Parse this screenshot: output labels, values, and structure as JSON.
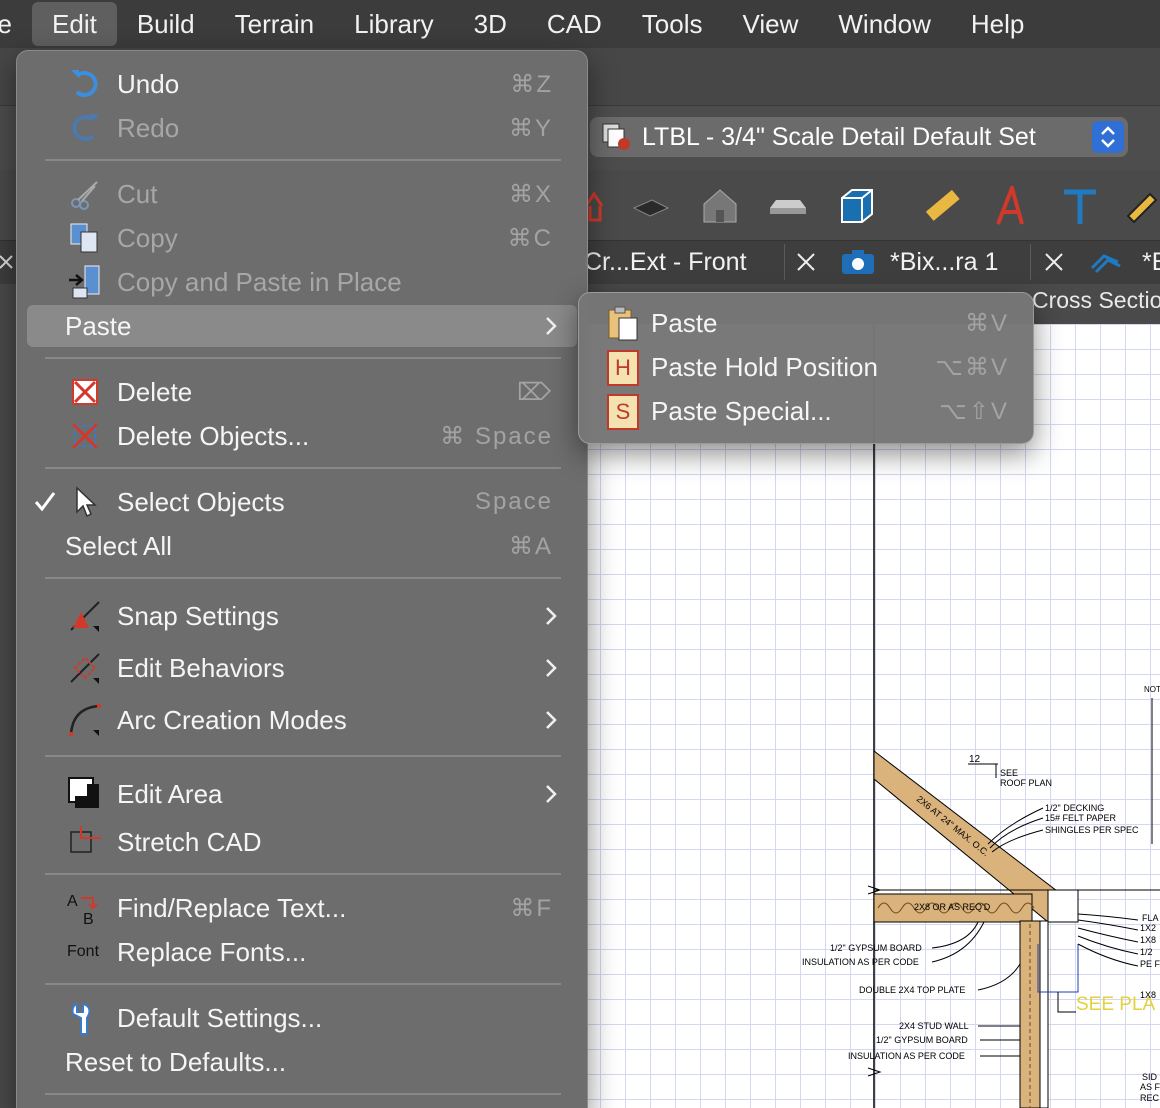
{
  "menubar": {
    "items": [
      "ile",
      "Edit",
      "Build",
      "Terrain",
      "Library",
      "3D",
      "CAD",
      "Tools",
      "View",
      "Window",
      "Help"
    ],
    "active": "Edit"
  },
  "toolbar": {
    "default_set": "LTBL - 3/4\" Scale Detail Default Set"
  },
  "tabs": {
    "tab1_label": "Cr...Ext - Front",
    "tab2_label": "*Bix...ra 1",
    "tab3_label": "*E",
    "cross_section_label": "Cross Sectio"
  },
  "edit_menu": {
    "undo": {
      "label": "Undo",
      "shortcut": "⌘Z"
    },
    "redo": {
      "label": "Redo",
      "shortcut": "⌘Y"
    },
    "cut": {
      "label": "Cut",
      "shortcut": "⌘X"
    },
    "copy": {
      "label": "Copy",
      "shortcut": "⌘C"
    },
    "copy_paste_in_place": {
      "label": "Copy and Paste in Place"
    },
    "paste": {
      "label": "Paste"
    },
    "delete": {
      "label": "Delete",
      "shortcut": "⌦"
    },
    "delete_objects": {
      "label": "Delete Objects...",
      "shortcut": "⌘ Space"
    },
    "select_objects": {
      "label": "Select Objects",
      "shortcut": "Space",
      "checked": true
    },
    "select_all": {
      "label": "Select All",
      "shortcut": "⌘A"
    },
    "snap_settings": {
      "label": "Snap Settings"
    },
    "edit_behaviors": {
      "label": "Edit Behaviors"
    },
    "arc_creation_modes": {
      "label": "Arc Creation Modes"
    },
    "edit_area": {
      "label": "Edit Area"
    },
    "stretch_cad": {
      "label": "Stretch CAD"
    },
    "find_replace_text": {
      "label": "Find/Replace Text...",
      "shortcut": "⌘F"
    },
    "replace_fonts": {
      "label": "Replace Fonts...",
      "icon_text": "Font"
    },
    "default_settings": {
      "label": "Default Settings..."
    },
    "reset_to_defaults": {
      "label": "Reset to Defaults..."
    }
  },
  "paste_submenu": {
    "paste": {
      "label": "Paste",
      "shortcut": "⌘V"
    },
    "paste_hold_position": {
      "label": "Paste Hold Position",
      "shortcut": "⌥⌘V",
      "icon_letter": "H"
    },
    "paste_special": {
      "label": "Paste Special...",
      "shortcut": "⌥⇧V",
      "icon_letter": "S"
    }
  },
  "drawing": {
    "dim_12": "12",
    "see_roof_plan_1": "SEE",
    "see_roof_plan_2": "ROOF PLAN",
    "rafter_label": "2X6 AT 24\" MAX. O.C.",
    "decking": "1/2\" DECKING",
    "felt": "15# FELT PAPER",
    "shingles": "SHINGLES PER SPEC",
    "joist_label": "2X8 OR AS REQ'D",
    "gypsum_1": "1/2\" GYPSUM BOARD",
    "insulation_1": "INSULATION AS PER CODE",
    "top_plate": "DOUBLE 2X4 TOP PLATE",
    "stud_wall": "2X4 STUD WALL",
    "gypsum_2": "1/2\" GYPSUM BOARD",
    "insulation_2": "INSULATION AS PER CODE",
    "see_plan": "SEE PLA",
    "note_hdr": "NOT",
    "fla": "FLA",
    "r1x2": "1X2",
    "r1x8": "1X8",
    "r12": "1/2",
    "rpe": "PE F",
    "r1x8b": "1X8",
    "sid": "SID",
    "asf": "AS F",
    "rec": "REC"
  },
  "colors": {
    "menu_bg": "#6e6e6e",
    "highlight": "#8a8a8a",
    "accent_blue": "#2f6fd6",
    "icon_red": "#d0392b",
    "wood": "#d9b27c",
    "grid": "#d3d7f0",
    "see_plan_yellow": "#e3d23b"
  }
}
